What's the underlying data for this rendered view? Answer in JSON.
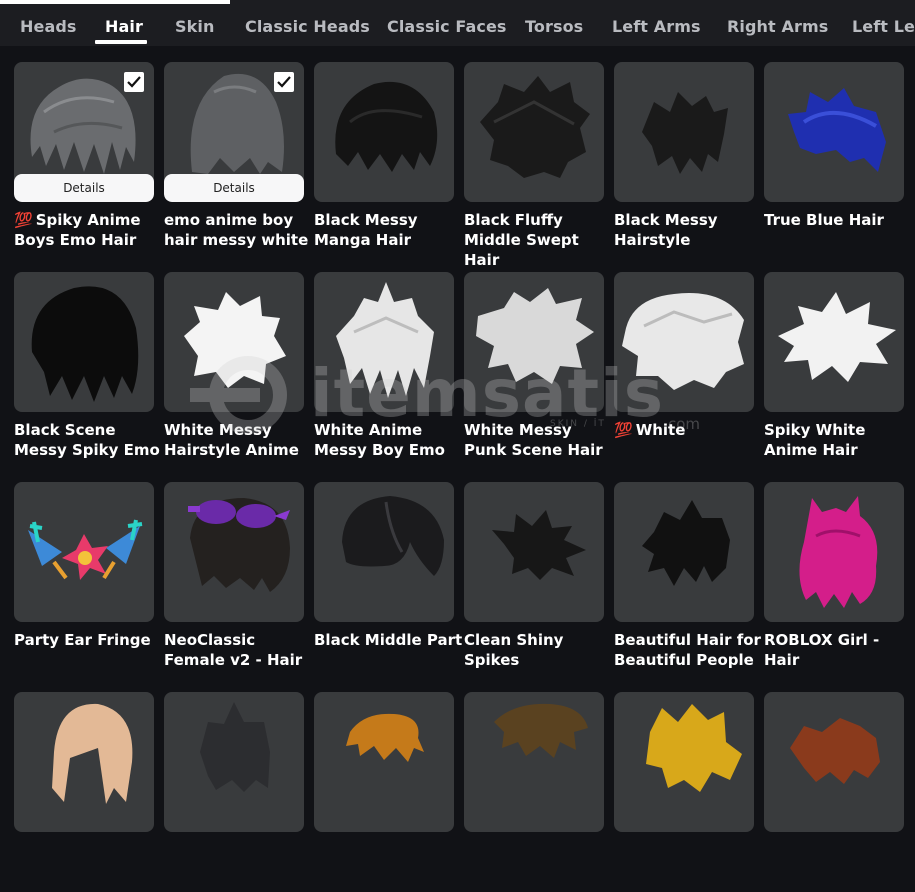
{
  "tabs": [
    {
      "label": "Heads"
    },
    {
      "label": "Hair"
    },
    {
      "label": "Skin"
    },
    {
      "label": "Classic Heads"
    },
    {
      "label": "Classic Faces"
    },
    {
      "label": "Torsos"
    },
    {
      "label": "Left Arms"
    },
    {
      "label": "Right Arms"
    },
    {
      "label": "Left Legs"
    }
  ],
  "active_tab": "Hair",
  "details_label": "Details",
  "badge_100": "💯",
  "watermark": {
    "text": "itemsatis",
    "sub": "SKIN / İT",
    "com": "com"
  },
  "items": [
    {
      "name": "Spiky Anime Boys Emo Hair",
      "equipped": true,
      "prefix": "💯"
    },
    {
      "name": "emo anime boy hair messy white",
      "equipped": true
    },
    {
      "name": "Black Messy Manga Hair"
    },
    {
      "name": "Black Fluffy Middle Swept Hair"
    },
    {
      "name": "Black Messy Hairstyle"
    },
    {
      "name": "True Blue Hair"
    },
    {
      "name": "Black Scene Messy Spiky Emo"
    },
    {
      "name": "White Messy Hairstyle Anime"
    },
    {
      "name": "White Anime Messy Boy Emo"
    },
    {
      "name": "White Messy Punk Scene Hair"
    },
    {
      "name": "White",
      "prefix": "💯"
    },
    {
      "name": "Spiky White Anime Hair"
    },
    {
      "name": "Party Ear Fringe"
    },
    {
      "name": "NeoClassic Female v2 - Hair"
    },
    {
      "name": "Black Middle Part"
    },
    {
      "name": "Clean Shiny Spikes"
    },
    {
      "name": "Beautiful Hair for Beautiful People"
    },
    {
      "name": "ROBLOX Girl - Hair"
    },
    {
      "name": ""
    },
    {
      "name": ""
    },
    {
      "name": ""
    },
    {
      "name": ""
    },
    {
      "name": ""
    },
    {
      "name": ""
    }
  ]
}
